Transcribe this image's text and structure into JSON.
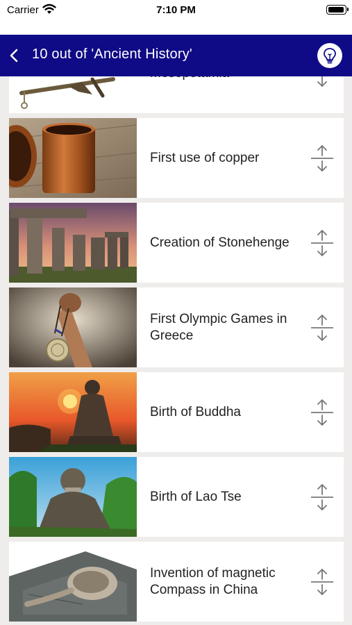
{
  "status_bar": {
    "carrier": "Carrier",
    "time": "7:10 PM",
    "icons": [
      "wifi-icon",
      "battery-icon"
    ]
  },
  "nav": {
    "title": "10 out of 'Ancient History'",
    "back_icon": "chevron-left-icon",
    "hint_icon": "lightbulb-icon",
    "bar_color": "#0f0a85"
  },
  "items": [
    {
      "label": "Mesopotamia",
      "image": "plough-photo"
    },
    {
      "label": "First use of copper",
      "image": "copper-cup-photo"
    },
    {
      "label": "Creation of Stonehenge",
      "image": "stonehenge-photo"
    },
    {
      "label": "First Olympic Games in Greece",
      "image": "olympic-medal-photo"
    },
    {
      "label": "Birth of Buddha",
      "image": "buddha-statue-photo"
    },
    {
      "label": "Birth of Lao Tse",
      "image": "lao-tse-statue-photo"
    },
    {
      "label": "Invention of magnetic Compass in China",
      "image": "compass-spoon-photo"
    }
  ]
}
